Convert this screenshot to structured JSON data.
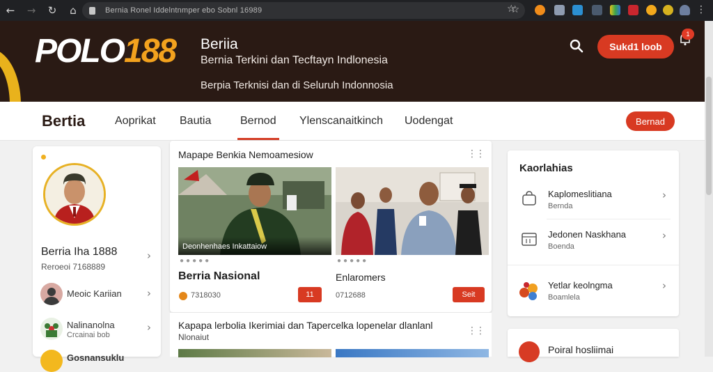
{
  "browser": {
    "url": "Bernia Ronel Iddelntnmper ebo Sobnl 16989"
  },
  "header": {
    "logo_white": "POLO",
    "logo_orange": "188",
    "title": "Beriia",
    "subtitle": "Bernia Terkini dan Tecftayn Indlonesia",
    "tagline": "Berpia Terknisi dan di Seluruh Indonnosia",
    "cta_label": "Sukd1 loob",
    "notification_badge": "1"
  },
  "nav": {
    "brand": "Bertia",
    "items": [
      {
        "label": "Aoprikat",
        "active": false
      },
      {
        "label": "Bautia",
        "active": false
      },
      {
        "label": "Bernod",
        "active": true
      },
      {
        "label": "Ylenscanaitkinch",
        "active": false
      },
      {
        "label": "Uodengat",
        "active": false
      }
    ],
    "button_label": "Bernad"
  },
  "profile": {
    "name": "Berria Iha 1888",
    "subtitle": "Reroeoi 7168889",
    "list": [
      {
        "label": "Meoic Kariian",
        "sub": ""
      },
      {
        "label": "Nalinanolna",
        "sub": "Crcainai bob"
      },
      {
        "label": "Gosnansuklu",
        "sub": ""
      }
    ]
  },
  "news": {
    "section_title": "Mapape Benkia Nemoamesiow",
    "cards": [
      {
        "caption": "Deonhenhaes Inkattaiow",
        "headline": "Berria Nasional",
        "meta": "7318030",
        "button": "11"
      },
      {
        "caption": "",
        "headline": "Enlaromers",
        "meta": "0712688",
        "button": "Seit"
      }
    ],
    "section2_title": "Kapapa lerbolia Ikerimiai dan Tapercelka lopenelar dlanlanl",
    "section2_sub": "Nlonaiut"
  },
  "sidebar": {
    "title": "Kaorlahias",
    "items": [
      {
        "label": "Kaplomeslitiana",
        "sub": "Bernda"
      },
      {
        "label": "Jedonen Naskhana",
        "sub": "Boenda"
      },
      {
        "label": "Yetlar keolngma",
        "sub": "Boamlela"
      }
    ],
    "card2_label": "Poiral hosliimai"
  },
  "colors": {
    "accent_red": "#d83a22",
    "logo_orange": "#f3a21e",
    "header_bg": "#2a1a14"
  }
}
